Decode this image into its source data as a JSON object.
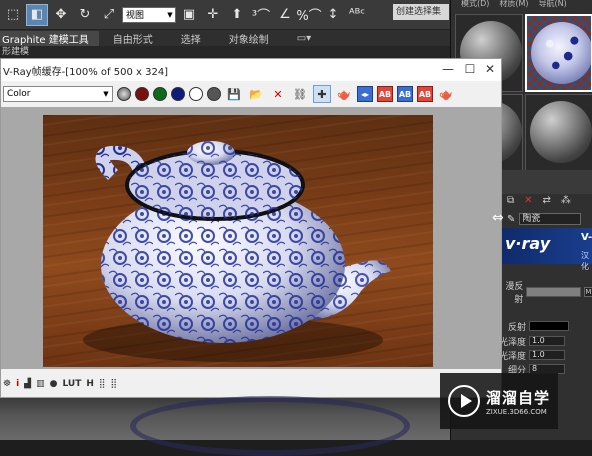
{
  "toolbar": {
    "view_select": "视图",
    "selection_set_field": "创建选择集"
  },
  "ribbon": {
    "tabs": [
      "Graphite 建模工具",
      "自由形式",
      "选择",
      "对象绘制"
    ],
    "sub_label": "形建模"
  },
  "right_panel": {
    "menu": [
      "模式(D)",
      "材质(M)",
      "导航(N)"
    ],
    "material_name": "陶瓷",
    "vray_logo": "v·ray",
    "vray_logo2": "V-",
    "vray_sub": "汉化",
    "params": {
      "reflect_label": "反射",
      "reflect_map_label": "漫反射",
      "gloss_label": "光泽度",
      "gloss_value": "1.0",
      "gloss2_label": "光泽度",
      "gloss2_value": "1.0",
      "subdiv_label": "细分",
      "subdiv_value": "8",
      "m_label": "M"
    }
  },
  "vfb": {
    "title": "V-Ray帧缓存-[100% of 500 x 324]",
    "channel_select": "Color",
    "status_labels": [
      "i",
      "LUT",
      "H"
    ]
  },
  "watermark": {
    "brand": "溜溜自学",
    "url": "ZIXUE.3D66.COM"
  },
  "colors": {
    "accent": "#5a86b0",
    "vray_blue": "#1a3e8e",
    "porcelain_blue": "#1d2a8a"
  }
}
